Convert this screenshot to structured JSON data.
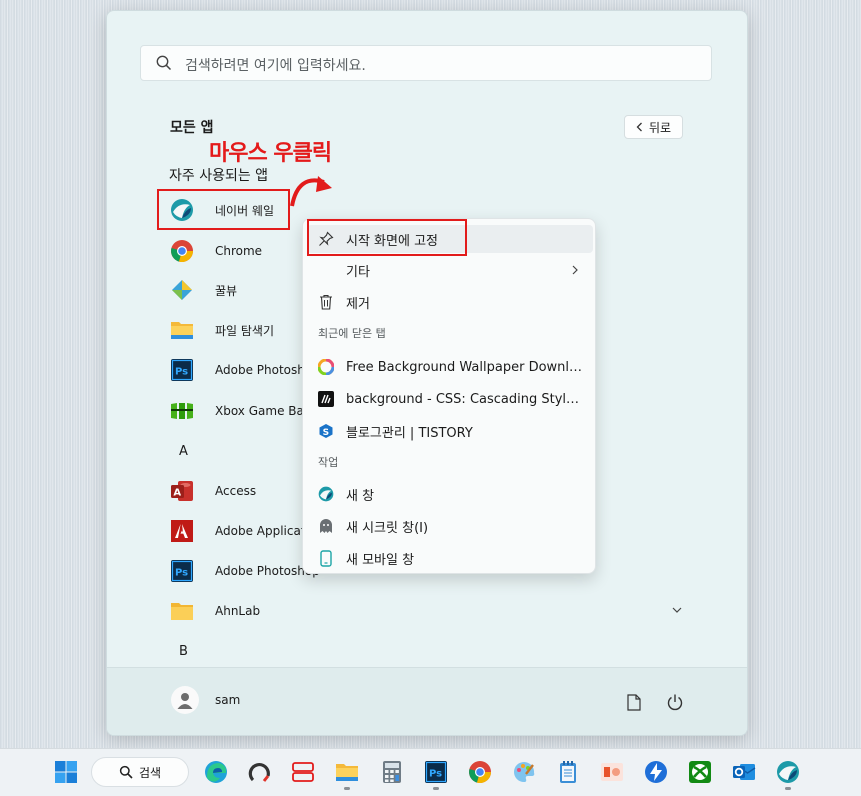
{
  "search": {
    "placeholder": "검색하려면 여기에 입력하세요."
  },
  "all_apps_title": "모든 앱",
  "back_button": "뒤로",
  "annotation": "마우스 우클릭",
  "frequent_title": "자주 사용되는 앱",
  "apps": [
    {
      "label": "네이버 웨일",
      "icon": "whale-icon"
    },
    {
      "label": "Chrome",
      "icon": "chrome-icon"
    },
    {
      "label": "꿀뷰",
      "icon": "honeyview-icon"
    },
    {
      "label": "파일 탐색기",
      "icon": "folder-icon"
    },
    {
      "label": "Adobe Photoshop",
      "icon": "photoshop-icon"
    },
    {
      "label": "Xbox Game Bar",
      "icon": "xbox-game-bar-icon"
    }
  ],
  "letter_a": "A",
  "apps_a": [
    {
      "label": "Access",
      "icon": "access-icon"
    },
    {
      "label": "Adobe Application Manager",
      "icon": "adobe-icon"
    },
    {
      "label": "Adobe Photoshop",
      "icon": "photoshop-icon"
    },
    {
      "label": "AhnLab",
      "icon": "folder-icon"
    }
  ],
  "letter_b": "B",
  "user": {
    "name": "sam"
  },
  "context_menu": {
    "pin": "시작 화면에 고정",
    "more": "기타",
    "remove": "제거",
    "recent_section": "최근에 닫은 탭",
    "recent_tabs": [
      "Free Background Wallpaper Downloads",
      "background - CSS: Cascading Style Sheets | MDN",
      "블로그관리 | TISTORY"
    ],
    "tasks_section": "작업",
    "tasks": [
      "새 창",
      "새 시크릿 창(I)",
      "새 모바일 창"
    ]
  },
  "taskbar": {
    "search_label": "검색"
  },
  "colors": {
    "highlight": "#e21b1b",
    "accent": "#0067c0"
  }
}
